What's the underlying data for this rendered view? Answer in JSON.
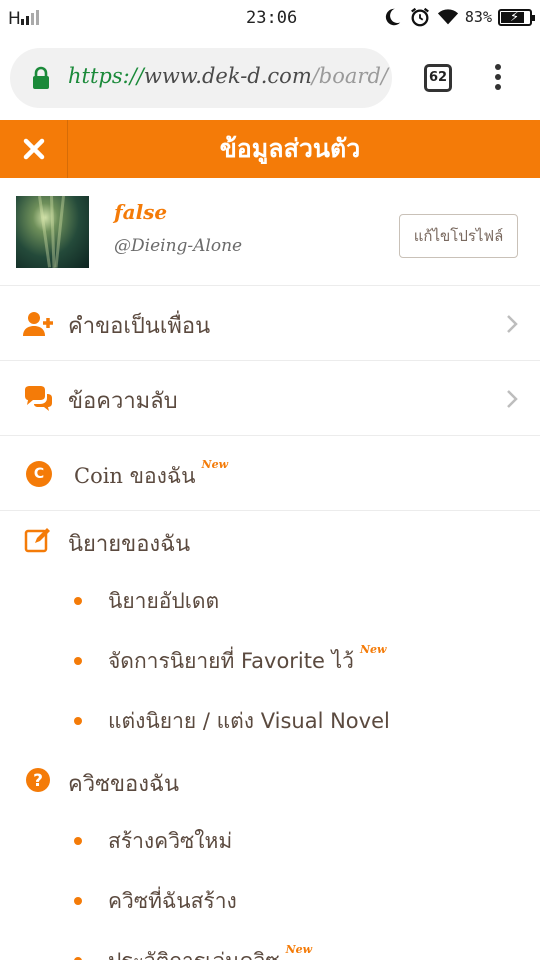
{
  "status_bar": {
    "signal": "H",
    "time": "23:06",
    "battery": "83%",
    "battery_level": 0.83,
    "icons": [
      "moon-icon",
      "alarm-icon",
      "wifi-icon",
      "battery-icon"
    ]
  },
  "browser": {
    "url_scheme": "https://",
    "url_host": "www.dek-d.com",
    "url_rest": "/board/",
    "tabs_count": "62"
  },
  "header": {
    "title": "ข้อมูลส่วนตัว"
  },
  "profile": {
    "name": "false",
    "handle": "@Dieing-Alone",
    "edit_label": "แก้ไขโปรไฟล์"
  },
  "menu": {
    "friend_requests": "คำขอเป็นเพื่อน",
    "private_messages": "ข้อความลับ",
    "coin_label": "Coin ของฉัน",
    "coin_badge": "C",
    "new_tag": "New"
  },
  "novel_section": {
    "title": "นิยายของฉัน",
    "items": [
      {
        "label": "นิยายอัปเดต"
      },
      {
        "label": "จัดการนิยายที่ Favorite ไว้",
        "new": "New"
      },
      {
        "label": "แต่งนิยาย / แต่ง Visual Novel"
      }
    ]
  },
  "quiz_section": {
    "title": "ควิซของฉัน",
    "items": [
      {
        "label": "สร้างควิซใหม่"
      },
      {
        "label": "ควิซที่ฉันสร้าง"
      },
      {
        "label": "ประวัติการเล่นควิซ",
        "new": "New"
      }
    ]
  },
  "colors": {
    "accent": "#f47b08",
    "text": "#5b4a3f",
    "url_green": "#1b8a3a"
  }
}
